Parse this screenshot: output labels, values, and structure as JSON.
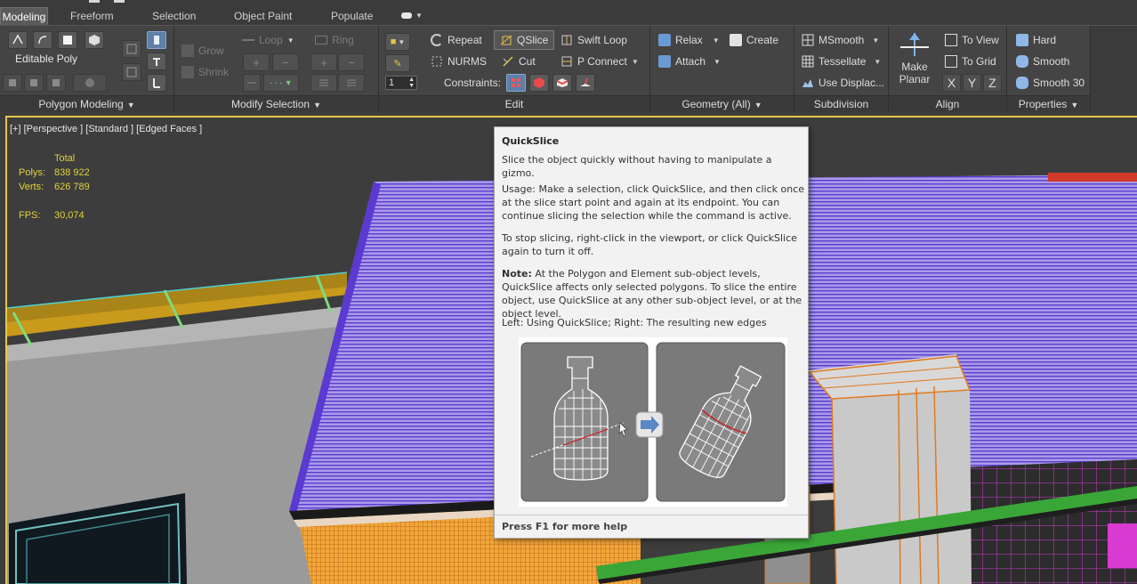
{
  "ribbon": {
    "tabs": [
      "Modeling",
      "Freeform",
      "Selection",
      "Object Paint",
      "Populate"
    ],
    "active_tab": "Modeling",
    "polygon_modeling": {
      "object_label": "Editable Poly",
      "footer": "Polygon Modeling"
    },
    "modify_selection": {
      "grow": "Grow",
      "shrink": "Shrink",
      "loop": "Loop",
      "ring": "Ring",
      "footer": "Modify Selection"
    },
    "edit": {
      "repeat": "Repeat",
      "qslice": "QSlice",
      "swift_loop": "Swift Loop",
      "nurms": "NURMS",
      "cut": "Cut",
      "p_connect": "P Connect",
      "constraints": "Constraints:",
      "spinner_value": "1",
      "footer": "Edit"
    },
    "geometry_all": {
      "relax": "Relax",
      "create": "Create",
      "attach": "Attach",
      "footer": "Geometry (All)"
    },
    "subdivision": {
      "msmooth": "MSmooth",
      "tessellate": "Tessellate",
      "use_displacement": "Use Displac...",
      "footer": "Subdivision"
    },
    "align": {
      "make_planar": [
        "Make",
        "Planar"
      ],
      "to_view": "To View",
      "to_grid": "To Grid",
      "x": "X",
      "y": "Y",
      "z": "Z",
      "footer": "Align"
    },
    "properties": {
      "hard": "Hard",
      "smooth": "Smooth",
      "smooth30": "Smooth 30",
      "footer": "Properties"
    }
  },
  "viewport": {
    "label": "[+] [Perspective ] [Standard ] [Edged Faces ]",
    "stats": {
      "header": "Total",
      "polys_label": "Polys:",
      "polys": "838 922",
      "verts_label": "Verts:",
      "verts": "626 789",
      "fps_label": "FPS:",
      "fps": "30,074"
    }
  },
  "tooltip": {
    "title": "QuickSlice",
    "summary": "Slice the object quickly without having to manipulate a gizmo.",
    "usage": "Usage: Make a selection, click QuickSlice, and then click once at the slice start point and again at its endpoint. You can continue slicing the selection while the command is active.",
    "stop": "To stop slicing, right-click in the viewport, or click QuickSlice again to turn it off.",
    "note_label": "Note:",
    "note": " At the Polygon and Element sub-object levels, QuickSlice affects only selected polygons. To slice the entire object, use QuickSlice at any other sub-object level, or at the object level.",
    "caption": "Left: Using QuickSlice; Right: The resulting new edges",
    "footer": "Press F1 for more help"
  },
  "colors": {
    "selection_border": "#e8c64a",
    "stats_text": "#e3d23a",
    "roof_purple": "#6a48d8",
    "orange_mesh": "#e07a20",
    "tooltip_bg": "#f2f2f2"
  }
}
